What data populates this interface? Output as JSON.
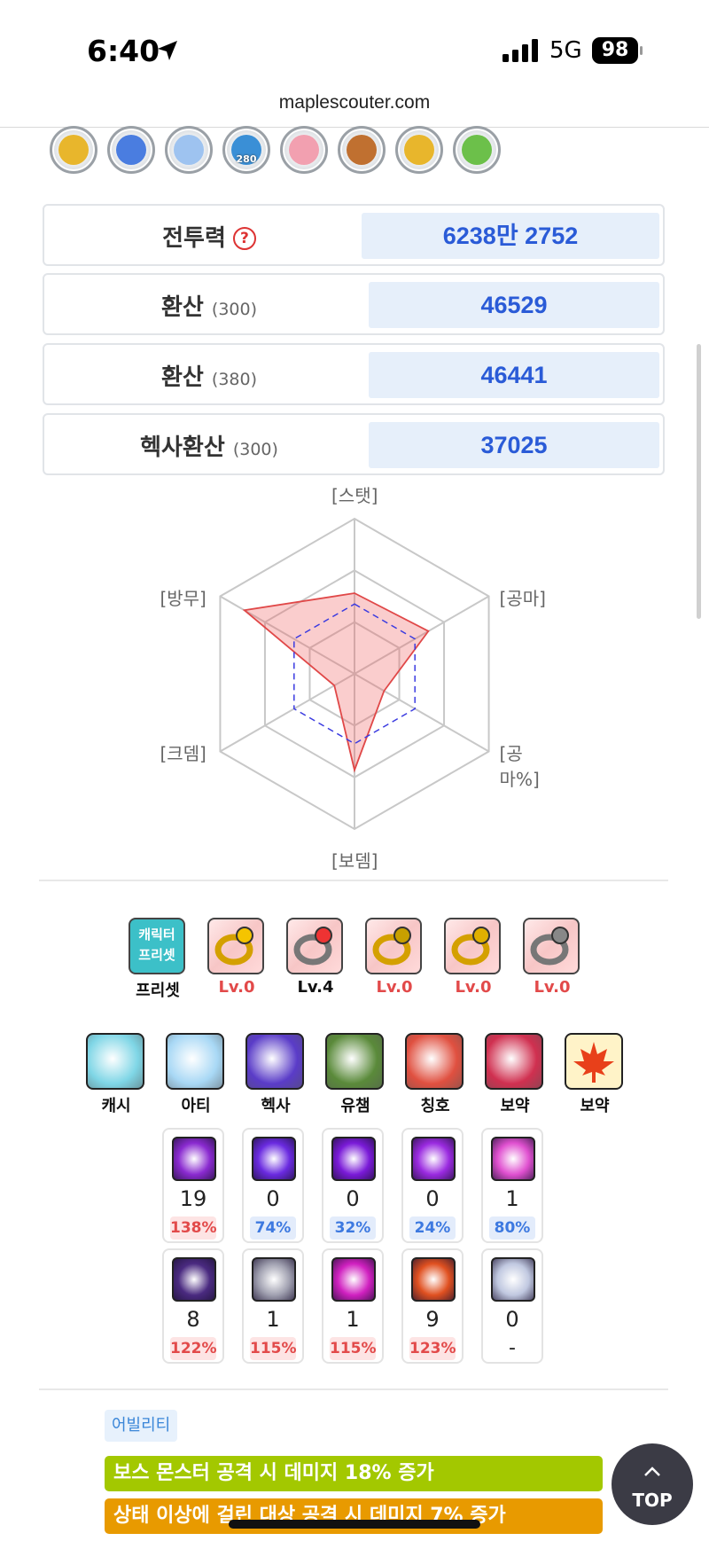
{
  "status_bar": {
    "time": "6:40",
    "network": "5G",
    "battery": "98"
  },
  "browser": {
    "url": "maplescouter.com"
  },
  "badges": [
    {
      "icon": "trophy-badge-icon",
      "color": "#e8b62c",
      "label": ""
    },
    {
      "icon": "blue-swirl-badge-icon",
      "color": "#4a7de0",
      "label": ""
    },
    {
      "icon": "diamond-badge-icon",
      "color": "#9ec3f0",
      "label": ""
    },
    {
      "icon": "level-280-badge-icon",
      "color": "#3a8fd6",
      "label": "280"
    },
    {
      "icon": "pink-character-badge-icon",
      "color": "#f2a0b0",
      "label": ""
    },
    {
      "icon": "star-hat-badge-icon",
      "color": "#c07030",
      "label": ""
    },
    {
      "icon": "gold-star-badge-icon",
      "color": "#e8b62c",
      "label": ""
    },
    {
      "icon": "green-slime-badge-icon",
      "color": "#6cc04a",
      "label": ""
    }
  ],
  "power": {
    "combat_power_label": "전투력",
    "combat_power_value": "6238만 2752",
    "rows": [
      {
        "label": "환산",
        "sub": "(300)",
        "value": "46529"
      },
      {
        "label": "환산",
        "sub": "(380)",
        "value": "46441"
      },
      {
        "label": "헥사환산",
        "sub": "(300)",
        "value": "37025"
      }
    ]
  },
  "chart_data": {
    "type": "radar",
    "axes": [
      "[스탯]",
      "[공마]",
      "[공마%]",
      "[보뎀]",
      "[크뎀]",
      "[방무]"
    ],
    "levels": 3,
    "series": [
      {
        "color": "#e04848",
        "values": [
          0.52,
          0.55,
          0.22,
          0.62,
          0.15,
          0.82
        ]
      },
      {
        "color": "#3a3ae0",
        "dashed": true,
        "values": [
          0.45,
          0.45,
          0.45,
          0.45,
          0.45,
          0.45
        ]
      }
    ]
  },
  "rings": [
    {
      "icon": "character-preset-icon",
      "caption": "프리셋",
      "caption_color": "#111111",
      "preset_text_1": "캐릭터",
      "preset_text_2": "프리셋"
    },
    {
      "icon": "ruby-ring-icon",
      "caption": "Lv.0",
      "caption_color": "#e24a4a"
    },
    {
      "icon": "crimson-ring-icon",
      "caption": "Lv.4",
      "caption_color": "#111111"
    },
    {
      "icon": "gold-gem-ring-icon",
      "caption": "Lv.0",
      "caption_color": "#e24a4a"
    },
    {
      "icon": "green-gold-ring-icon",
      "caption": "Lv.0",
      "caption_color": "#e24a4a"
    },
    {
      "icon": "pink-gem-ring-icon",
      "caption": "Lv.0",
      "caption_color": "#e24a4a"
    }
  ],
  "equipment_tabs": [
    {
      "icon": "cash-helmet-icon",
      "caption": "캐시"
    },
    {
      "icon": "blue-mushroom-icon",
      "caption": "아티"
    },
    {
      "icon": "hexa-galaxy-icon",
      "caption": "헥사"
    },
    {
      "icon": "union-champion-icon",
      "caption": "유챔"
    },
    {
      "icon": "title-book-icon",
      "caption": "칭호"
    },
    {
      "icon": "red-haired-character-icon",
      "caption": "보약"
    },
    {
      "icon": "maple-leaf-icon",
      "caption": "보약"
    }
  ],
  "skills_row1": [
    {
      "icon": "purple-claw-skill-icon",
      "level": "19",
      "pct": "138%",
      "pct_style": "red"
    },
    {
      "icon": "violet-sparkle-skill-icon",
      "level": "0",
      "pct": "74%",
      "pct_style": "blue"
    },
    {
      "icon": "purple-crystal-skill-icon",
      "level": "0",
      "pct": "32%",
      "pct_style": "blue"
    },
    {
      "icon": "crossed-blades-skill-icon",
      "level": "0",
      "pct": "24%",
      "pct_style": "blue"
    },
    {
      "icon": "pink-orb-skill-icon",
      "level": "1",
      "pct": "80%",
      "pct_style": "blue"
    }
  ],
  "skills_row2": [
    {
      "icon": "dark-star-skill-icon",
      "level": "8",
      "pct": "122%",
      "pct_style": "red"
    },
    {
      "icon": "white-swirl-skill-icon",
      "level": "1",
      "pct": "115%",
      "pct_style": "red"
    },
    {
      "icon": "magenta-orb-skill-icon",
      "level": "1",
      "pct": "115%",
      "pct_style": "red"
    },
    {
      "icon": "orange-emblem-skill-icon",
      "level": "9",
      "pct": "123%",
      "pct_style": "red"
    },
    {
      "icon": "ring-link-skill-icon",
      "level": "0",
      "pct": "-",
      "pct_style": "none"
    }
  ],
  "ability": {
    "tag": "어빌리티",
    "lines": [
      {
        "text": "보스 몬스터 공격 시 데미지 18% 증가",
        "color": "#a3c800"
      },
      {
        "text": "상태 이상에 걸린 대상 공격 시 데미지 7% 증가",
        "color": "#e89a00"
      }
    ]
  },
  "top_button": {
    "label": "TOP"
  }
}
